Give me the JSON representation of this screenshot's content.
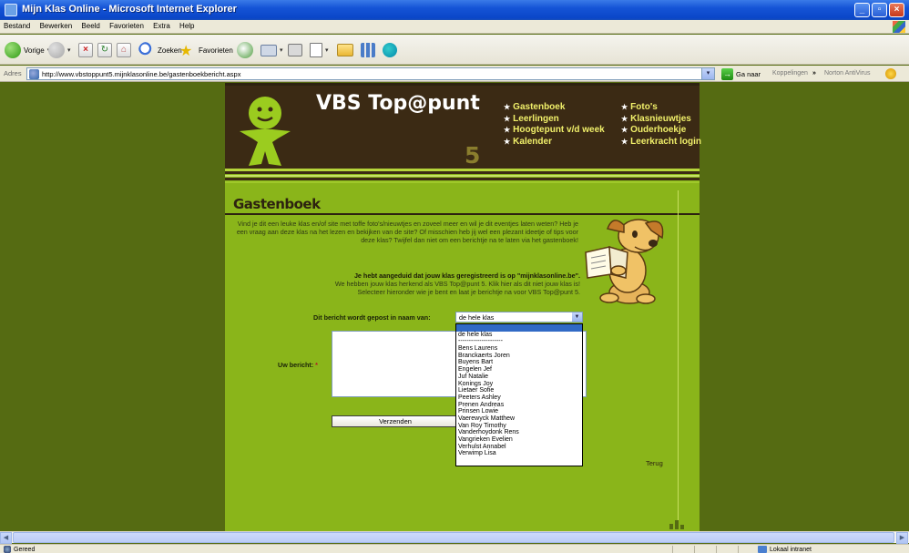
{
  "window": {
    "title": "Mijn Klas Online - Microsoft Internet Explorer"
  },
  "menu": [
    "Bestand",
    "Bewerken",
    "Beeld",
    "Favorieten",
    "Extra",
    "Help"
  ],
  "toolbar": {
    "back": "Vorige",
    "search": "Zoeken",
    "favorites": "Favorieten"
  },
  "address": {
    "label": "Adres",
    "url": "http://www.vbstoppunt5.mijnklasonline.be/gastenboekbericht.aspx",
    "go": "Ga naar",
    "links": "Koppelingen",
    "chevron": "»",
    "norton": "Norton AntiVirus"
  },
  "site": {
    "title": "VBS Top@punt",
    "number": "5",
    "nav_left": [
      "Gastenboek",
      "Leerlingen",
      "Hoogtepunt v/d week",
      "Kalender"
    ],
    "nav_right": [
      "Foto's",
      "Klasnieuwtjes",
      "Ouderhoekje",
      "Leerkracht login"
    ],
    "star": "★"
  },
  "page": {
    "heading": "Gastenboek",
    "intro": "Vind je dit een leuke klas en/of site met toffe foto's/nieuwtjes en zoveel meer en wil je dit eventjes laten weten? Heb je een vraag aan deze klas na het lezen en bekijken van de site? Of misschien heb jij wel een plezant ideetje of tips voor deze klas? Twijfel dan niet om een berichtje na te laten via het gastenboek!",
    "notice_bold": "Je hebt aangeduid dat jouw klas geregistreerd is op \"mijnklasonline.be\".",
    "notice_line2": "We hebben jouw klas herkend als VBS Top@punt 5. Klik hier als dit niet jouw klas is!",
    "notice_line3": "Selecteer hieronder wie je bent en laat je berichtje na voor VBS Top@punt 5.",
    "sender_label": "Dit bericht wordt gepost in naam van:",
    "sender_selected": "de hele klas",
    "sender_options": [
      "",
      "de hele klas",
      "---------------------",
      "Bens Laurens",
      "Branckaerts Joren",
      "Buyens Bart",
      "Engelen Jef",
      "Juf Natalie",
      "Konings Joy",
      "Lietaer Sofie",
      "Peeters Ashley",
      "Prenen Andreas",
      "Prinsen Lowie",
      "Vaerewyck Matthew",
      "Van Roy Timothy",
      "Vanderhoydonk Rens",
      "Vangrieken Evelien",
      "Verhulst Annabel",
      "Verwimp Lisa"
    ],
    "message_label": "Uw bericht:",
    "required_mark": "*",
    "send_button": "Verzenden",
    "back_link": "Terug"
  },
  "status": {
    "left": "Gereed",
    "zone": "Lokaal intranet"
  },
  "colors": {
    "page_bg": "#556b12",
    "site_bg": "#8ab51a",
    "header_bg": "#3b2a14",
    "nav_text": "#f1f06a"
  }
}
